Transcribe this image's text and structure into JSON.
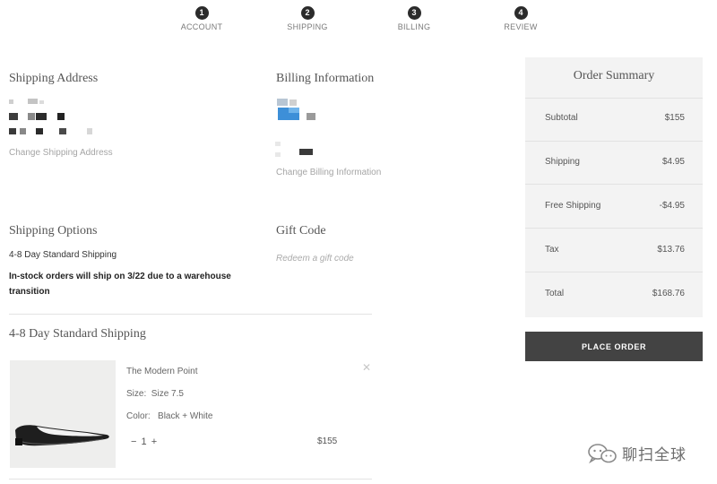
{
  "stepper": [
    {
      "number": "1",
      "label": "ACCOUNT"
    },
    {
      "number": "2",
      "label": "SHIPPING"
    },
    {
      "number": "3",
      "label": "BILLING"
    },
    {
      "number": "4",
      "label": "REVIEW"
    }
  ],
  "shipping_address": {
    "heading": "Shipping Address",
    "change_link": "Change Shipping Address"
  },
  "billing": {
    "heading": "Billing Information",
    "change_link": "Change Billing Information"
  },
  "shipping_options": {
    "heading": "Shipping Options",
    "selected": "4-8 Day Standard Shipping",
    "notice": "In-stock orders will ship on 3/22 due to a warehouse transition"
  },
  "gift_code": {
    "heading": "Gift Code",
    "placeholder": "Redeem a gift code"
  },
  "shipment": {
    "heading": "4-8 Day Standard Shipping",
    "item": {
      "name": "The Modern Point",
      "size_label": "Size:",
      "size_value": "Size 7.5",
      "color_label": "Color:",
      "color_value": "Black + White",
      "qty_minus": "−",
      "qty": "1",
      "qty_plus": "+",
      "price": "$155",
      "remove_icon": "close-icon"
    }
  },
  "order_summary": {
    "title": "Order Summary",
    "rows": [
      {
        "label": "Subtotal",
        "value": "$155"
      },
      {
        "label": "Shipping",
        "value": "$4.95"
      },
      {
        "label": "Free Shipping",
        "value": "-$4.95"
      },
      {
        "label": "Tax",
        "value": "$13.76"
      },
      {
        "label": "Total",
        "value": "$168.76"
      }
    ],
    "place_order_label": "PLACE ORDER"
  },
  "watermark": {
    "text": "聊扫全球",
    "icon": "wechat-icon"
  },
  "colors": {
    "step_circle": "#2b2b2b",
    "summary_bg": "#f3f3f3",
    "place_order_bg": "#434343",
    "link_muted": "#a5a5a5"
  }
}
